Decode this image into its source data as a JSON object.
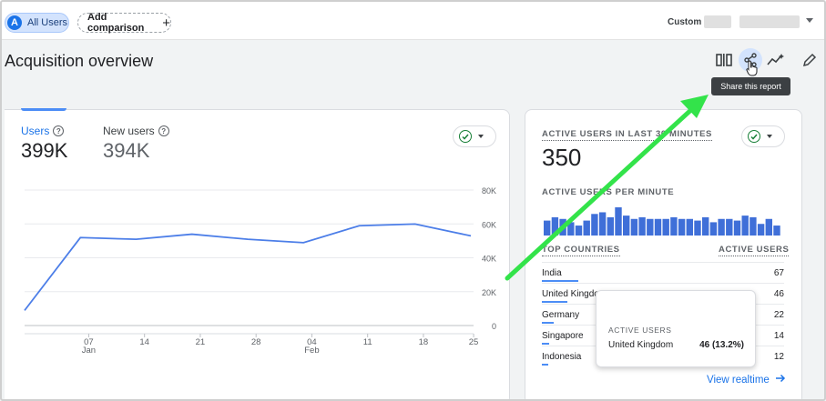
{
  "topbar": {
    "segment_avatar": "A",
    "segment_label": "All Users",
    "add_comparison_label": "Add comparison",
    "date_mode_label": "Custom"
  },
  "header": {
    "title": "Acquisition overview",
    "tooltip": "Share this report",
    "tools": [
      "compare-icon",
      "share-icon",
      "insights-icon",
      "edit-icon"
    ]
  },
  "main_card": {
    "metrics": [
      {
        "label": "Users",
        "value": "399K"
      },
      {
        "label": "New users",
        "value": "394K"
      }
    ]
  },
  "chart_data": {
    "type": "line",
    "title": "",
    "xlabel": "",
    "ylabel": "",
    "x_tick_labels": [
      {
        "day": "07",
        "month": "Jan"
      },
      {
        "day": "14",
        "month": ""
      },
      {
        "day": "21",
        "month": ""
      },
      {
        "day": "28",
        "month": ""
      },
      {
        "day": "04",
        "month": "Feb"
      },
      {
        "day": "11",
        "month": ""
      },
      {
        "day": "18",
        "month": ""
      },
      {
        "day": "25",
        "month": ""
      }
    ],
    "y_tick_labels": [
      "80K",
      "60K",
      "40K",
      "20K",
      "0"
    ],
    "ylim": [
      0,
      80000
    ],
    "grid": true,
    "series": [
      {
        "color": "#4c7ee8",
        "points": [
          {
            "x": 0,
            "y": 10000
          },
          {
            "x": 1,
            "y": 53000
          },
          {
            "x": 2,
            "y": 52000
          },
          {
            "x": 3,
            "y": 55000
          },
          {
            "x": 4,
            "y": 52000
          },
          {
            "x": 5,
            "y": 50000
          },
          {
            "x": 6,
            "y": 60000
          },
          {
            "x": 7,
            "y": 61000
          },
          {
            "x": 8,
            "y": 54000
          }
        ]
      }
    ],
    "x_tick_positions": [
      1.2,
      2.2,
      3.2,
      4.2,
      5.2,
      6.2,
      7.2,
      8.1
    ]
  },
  "side_card": {
    "kicker": "ACTIVE USERS IN LAST 30 MINUTES",
    "value": "350",
    "per_minute_label": "ACTIVE USERS PER MINUTE",
    "per_minute_values": [
      9,
      11,
      10,
      8,
      6,
      9,
      13,
      14,
      11,
      17,
      12,
      10,
      11,
      10,
      10,
      10,
      11,
      10,
      10,
      9,
      11,
      8,
      10,
      10,
      9,
      12,
      11,
      7,
      10,
      6
    ],
    "countries_header": "TOP COUNTRIES",
    "users_header": "ACTIVE USERS",
    "countries": [
      {
        "name": "India",
        "value": "67",
        "share": 1.0
      },
      {
        "name": "United Kingdom",
        "value": "46",
        "share": 0.69
      },
      {
        "name": "Germany",
        "value": "22",
        "share": 0.33
      },
      {
        "name": "Singapore",
        "value": "14",
        "share": 0.21
      },
      {
        "name": "Indonesia",
        "value": "12",
        "share": 0.18
      }
    ],
    "view_realtime_label": "View realtime"
  },
  "hover_tooltip": {
    "kicker": "ACTIVE USERS",
    "country": "United Kingdom",
    "value": "46 (13.2%)"
  },
  "colors": {
    "accent": "#1a73e8",
    "series": "#4c7ee8",
    "bars": "#3f6fd8",
    "annotation_arrow": "#33e34a"
  }
}
